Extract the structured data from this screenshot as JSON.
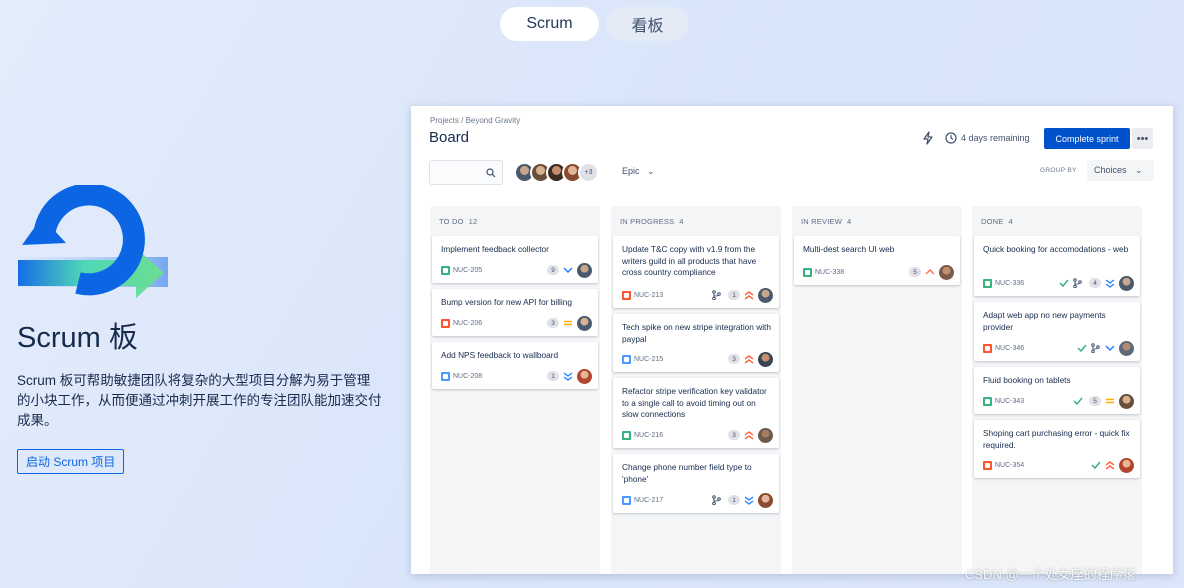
{
  "toggle": {
    "active": "Scrum",
    "inactive": "看板"
  },
  "hero": {
    "title": "Scrum 板",
    "description": "Scrum 板可帮助敏捷团队将复杂的大型项目分解为易于管理的小块工作，从而便通过冲刺开展工作的专注团队能加速交付成果。",
    "button": "启动 Scrum 项目"
  },
  "board": {
    "breadcrumb": "Projects / Beyond Gravity",
    "title": "Board",
    "days_remaining": "4 days remaining",
    "complete_sprint": "Complete sprint",
    "more": "•••",
    "avatar_more": "+3",
    "epic": "Epic",
    "group_by": "GROUP BY",
    "choices": "Choices",
    "columns": [
      {
        "name": "TO DO",
        "count": "12",
        "cards": [
          {
            "title": "Implement feedback collector",
            "key": "NUC-205",
            "type": "story",
            "points": "9",
            "priority": "low"
          },
          {
            "title": "Bump version for new API for billing",
            "key": "NUC-206",
            "type": "bug",
            "points": "3",
            "priority": "medium"
          },
          {
            "title": "Add NPS feedback to wallboard",
            "key": "NUC-208",
            "type": "task",
            "points": "1",
            "priority": "lowest"
          }
        ]
      },
      {
        "name": "IN PROGRESS",
        "count": "4",
        "cards": [
          {
            "title": "Update T&C copy with v1.9 from the writers guild in all products that have cross country compliance",
            "key": "NUC-213",
            "type": "bug",
            "points": "1",
            "priority": "highest"
          },
          {
            "title": "Tech spike on new stripe integration with paypal",
            "key": "NUC-215",
            "type": "task",
            "points": "3",
            "priority": "highest"
          },
          {
            "title": "Refactor stripe verification key validator to a single call to avoid timing out on slow connections",
            "key": "NUC-216",
            "type": "story",
            "points": "3",
            "priority": "highest"
          },
          {
            "title": "Change phone number field type to 'phone'",
            "key": "NUC-217",
            "type": "task",
            "points": "1",
            "priority": "lowest"
          }
        ]
      },
      {
        "name": "IN REVIEW",
        "count": "4",
        "cards": [
          {
            "title": "Multi-dest search UI web",
            "key": "NUC-338",
            "type": "story",
            "points": "5",
            "priority": "high"
          }
        ]
      },
      {
        "name": "DONE",
        "count": "4",
        "cards": [
          {
            "title": "Quick booking for accomodations - web",
            "key": "NUC-336",
            "type": "story",
            "points": "4",
            "priority": "lowest"
          },
          {
            "title": "Adapt web app no new payments provider",
            "key": "NUC-346",
            "type": "bug",
            "points": "",
            "priority": "low"
          },
          {
            "title": "Fluid booking on tablets",
            "key": "NUC-343",
            "type": "story",
            "points": "5",
            "priority": "medium"
          },
          {
            "title": "Shoping cart purchasing error - quick fix required.",
            "key": "NUC-354",
            "type": "bug",
            "points": "",
            "priority": "highest"
          }
        ]
      }
    ]
  },
  "watermark": "CSDN @一个处女座的程序猿"
}
